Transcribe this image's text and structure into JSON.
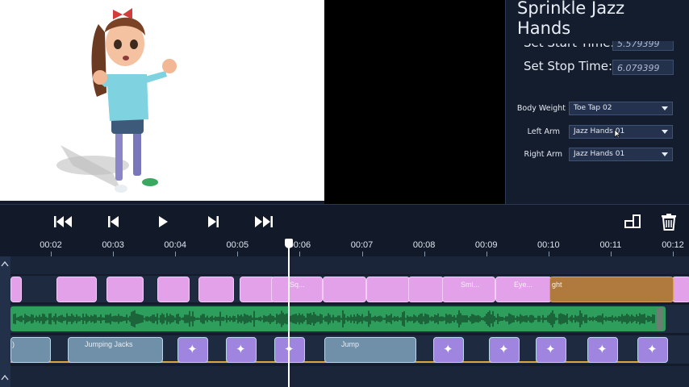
{
  "properties": {
    "title": "Sprinkle Jazz Hands",
    "set_start_label": "Set Start Time:",
    "set_start_value": "5.579399",
    "set_stop_label": "Set Stop Time:",
    "set_stop_value": "6.079399",
    "body_weight_label": "Body Weight",
    "body_weight_value": "Toe Tap 02",
    "left_arm_label": "Left Arm",
    "left_arm_value": "Jazz Hands 01",
    "right_arm_label": "Right Arm",
    "right_arm_value": "Jazz Hands 01"
  },
  "ruler": [
    "00:02",
    "00:03",
    "00:04",
    "00:05",
    "00:06",
    "00:07",
    "00:08",
    "00:09",
    "00:10",
    "00:11",
    "00:12"
  ],
  "clips": {
    "face_1": "Sq...",
    "face_2": "Smi...",
    "face_3": "Eye...",
    "face_4": "ght",
    "body_1": "Jumping Jacks",
    "body_2": "Jump",
    "body_0": ")"
  },
  "colors": {
    "face_clip": "#e3a1e9",
    "face_clip_long": "#b07a3e",
    "audio": "#2e9e5c",
    "body_clip": "#6f90a8",
    "sparkle_clip": "#9f85e0",
    "playhead": "#ffffff"
  }
}
